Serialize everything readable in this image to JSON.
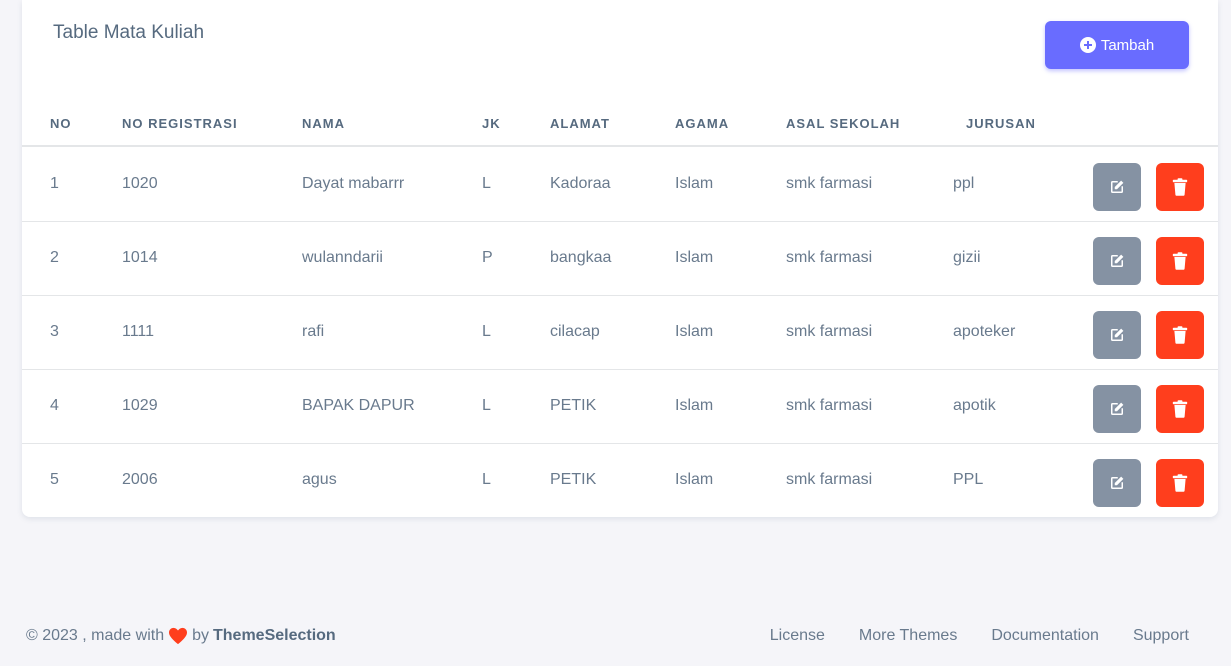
{
  "card": {
    "title": "Table Mata Kuliah",
    "add_button_label": "Tambah"
  },
  "table": {
    "headers": [
      "NO",
      "NO REGISTRASI",
      "NAMA",
      "JK",
      "ALAMAT",
      "AGAMA",
      "ASAL SEKOLAH",
      "JURUSAN"
    ],
    "rows": [
      {
        "no": "1",
        "reg": "1020",
        "nama": "Dayat mabarrr",
        "jk": "L",
        "alamat": "Kadoraa",
        "agama": "Islam",
        "asal": "smk farmasi",
        "jurusan": "ppl"
      },
      {
        "no": "2",
        "reg": "1014",
        "nama": "wulanndarii",
        "jk": "P",
        "alamat": "bangkaa",
        "agama": "Islam",
        "asal": "smk farmasi",
        "jurusan": "gizii"
      },
      {
        "no": "3",
        "reg": "1111",
        "nama": "rafi",
        "jk": "L",
        "alamat": "cilacap",
        "agama": "Islam",
        "asal": "smk farmasi",
        "jurusan": "apoteker"
      },
      {
        "no": "4",
        "reg": "1029",
        "nama": "BAPAK DAPUR",
        "jk": "L",
        "alamat": "PETIK",
        "agama": "Islam",
        "asal": "smk farmasi",
        "jurusan": "apotik"
      },
      {
        "no": "5",
        "reg": "2006",
        "nama": "agus",
        "jk": "L",
        "alamat": "PETIK",
        "agama": "Islam",
        "asal": "smk farmasi",
        "jurusan": "PPL"
      }
    ]
  },
  "footer": {
    "copyright_prefix": "© 2023 , made with",
    "by": "by",
    "brand": "ThemeSelection",
    "links": [
      "License",
      "More Themes",
      "Documentation",
      "Support"
    ]
  },
  "colors": {
    "primary": "#696cff",
    "secondary": "#8592a3",
    "danger": "#ff3e1d",
    "heart": "#ff3e1d"
  },
  "icons": {
    "add": "plus-circle-icon",
    "edit": "edit-icon",
    "delete": "trash-icon",
    "heart": "heart-icon"
  }
}
